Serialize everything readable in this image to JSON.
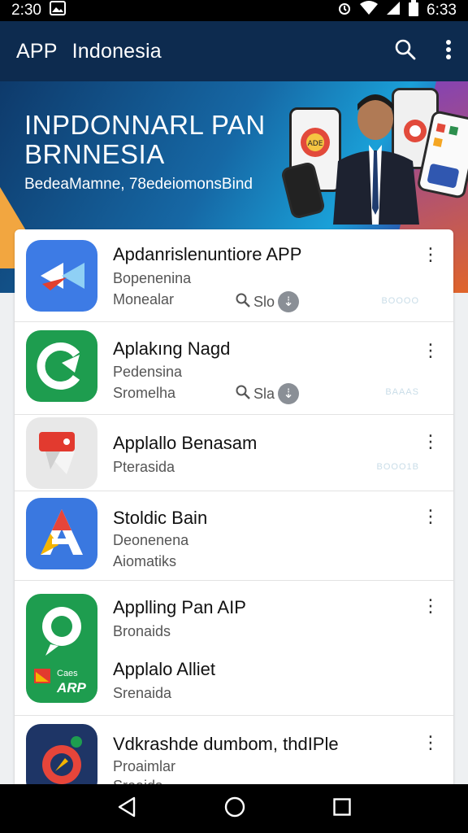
{
  "status_bar": {
    "time_left": "2:30",
    "time_right": "6:33"
  },
  "app_bar": {
    "app_label": "APP",
    "title": "Indonesia"
  },
  "banner": {
    "headline": "INPDONNARL PAN BRNNESIA",
    "subline": "BedeaMamne, 78edeiomonsBind"
  },
  "apps": [
    {
      "name": "Apdanrislenuntiore APP",
      "line1": "Bopenenina",
      "line2": "Monealar",
      "badge_text": "Slo",
      "side_text": "BOOOO"
    },
    {
      "name": "Aplakıng Nagd",
      "line1": "Pedensina",
      "line2": "Sromelha",
      "badge_text": "Sla",
      "side_text": "BAAAS"
    },
    {
      "name": "Applallo Benasam",
      "line1": "Pterasida",
      "line2": "",
      "badge_text": "",
      "side_text": "BOOO1B"
    },
    {
      "name": "Stoldic Bain",
      "line1": "Deonenena",
      "line2": "Aiomatiks",
      "badge_text": "",
      "side_text": ""
    },
    {
      "name": "Applling Pan AIP",
      "line1": "Bronaids",
      "line2": "",
      "name2": "Applalo Alliet",
      "line3": "Srenaida",
      "badge_text": "",
      "side_text": ""
    },
    {
      "name": "Vdkrashde dumbom, thdIPle",
      "line1": "Proaimlar",
      "line2": "Sroaids",
      "badge_text": "",
      "side_text": ""
    }
  ],
  "icon5_texts": {
    "tag": "Caes",
    "brand": "ARP"
  },
  "colors": {
    "appbar": "#0d2b4f",
    "statusbar": "#000000",
    "card": "#ffffff"
  }
}
